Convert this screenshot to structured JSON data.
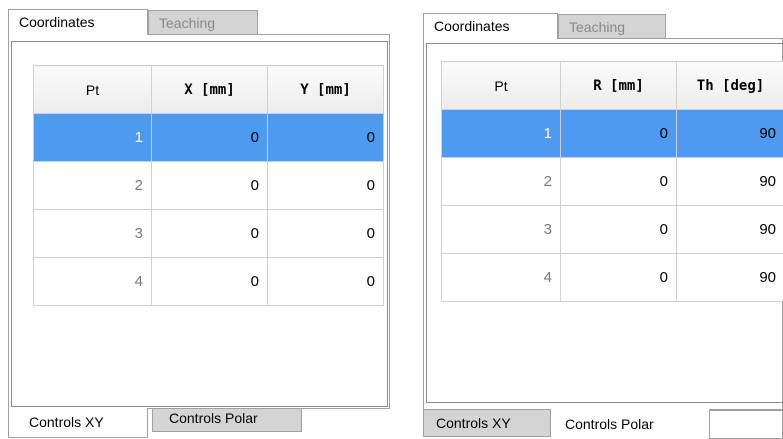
{
  "left_panel": {
    "top_tabs": [
      "Coordinates",
      "Teaching"
    ],
    "columns": [
      "Pt",
      "X [mm]",
      "Y [mm]"
    ],
    "rows": [
      [
        "1",
        "0",
        "0"
      ],
      [
        "2",
        "0",
        "0"
      ],
      [
        "3",
        "0",
        "0"
      ],
      [
        "4",
        "0",
        "0"
      ]
    ],
    "bottom_tabs": [
      "Controls XY",
      "Controls Polar"
    ]
  },
  "right_panel": {
    "top_tabs": [
      "Coordinates",
      "Teaching"
    ],
    "columns": [
      "Pt",
      "R [mm]",
      "Th [deg]"
    ],
    "rows": [
      [
        "1",
        "0",
        "90"
      ],
      [
        "2",
        "0",
        "90"
      ],
      [
        "3",
        "0",
        "90"
      ],
      [
        "4",
        "0",
        "90"
      ]
    ],
    "bottom_tabs": [
      "Controls XY",
      "Controls Polar"
    ]
  },
  "colors": {
    "selection": "#4d9af0",
    "inactive_tab": "#d4d4d4",
    "border": "#a0a0a0"
  }
}
